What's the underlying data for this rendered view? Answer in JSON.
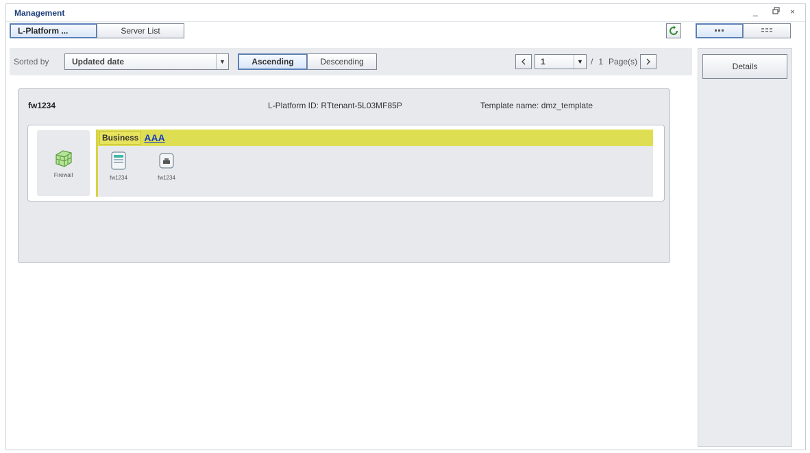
{
  "window": {
    "title": "Management",
    "controls": [
      "_",
      "↗",
      "×"
    ]
  },
  "tabs": [
    {
      "label": "L-Platform ...",
      "active": true
    },
    {
      "label": "Server List",
      "active": false
    }
  ],
  "view_toggle": {
    "list_icon": "list-view-icon",
    "grid_icon": "grid-view-icon"
  },
  "sort": {
    "label": "Sorted by",
    "selected": "Updated date",
    "ascending": "Ascending",
    "descending": "Descending"
  },
  "pager": {
    "current": "1",
    "separator": "/",
    "total": "1",
    "unit": "Page(s)"
  },
  "side": {
    "details_label": "Details"
  },
  "platform": {
    "name": "fw1234",
    "id_text": "L-Platform ID: RTtenant-5L03MF85P",
    "template_text": "Template name: dmz_template",
    "firewall_label": "Firewall",
    "segment": {
      "type": "Business",
      "name": "AAA",
      "nodes": [
        {
          "label": "fw1234",
          "icon": "server-icon"
        },
        {
          "label": "fw1234",
          "icon": "disk-icon"
        }
      ]
    }
  },
  "colors": {
    "accent": "#5b7fb6",
    "segment_header": "#dede52",
    "link": "#1a3fc7",
    "title": "#1f3f7a",
    "refresh": "#2e8b2e"
  }
}
